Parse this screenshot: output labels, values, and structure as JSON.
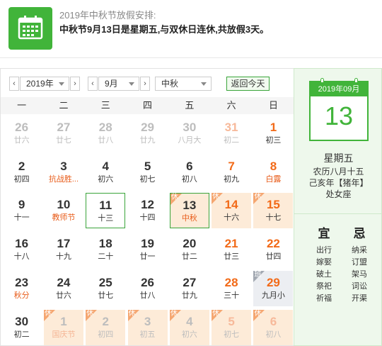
{
  "notice": {
    "title": "2019年中秋节放假安排:",
    "body": "中秋节9月13日是星期五,与双休日连休,共放假3天。",
    "icon": "calendar-icon"
  },
  "toolbar": {
    "prev_year": "‹",
    "year": "2019年",
    "next_year": "›",
    "prev_month": "‹",
    "month": "9月",
    "next_month": "›",
    "festival": "中秋",
    "today_label": "返回今天"
  },
  "weekdays": [
    "一",
    "二",
    "三",
    "四",
    "五",
    "六",
    "日"
  ],
  "days": [
    {
      "num": "26",
      "lunar": "廿六",
      "dim": true
    },
    {
      "num": "27",
      "lunar": "廿七",
      "dim": true
    },
    {
      "num": "28",
      "lunar": "廿八",
      "dim": true
    },
    {
      "num": "29",
      "lunar": "廿九",
      "dim": true
    },
    {
      "num": "30",
      "lunar": "八月大",
      "dim": true
    },
    {
      "num": "31",
      "lunar": "初二",
      "dim": true,
      "weekend": true
    },
    {
      "num": "1",
      "lunar": "初三",
      "weekend": true
    },
    {
      "num": "2",
      "lunar": "初四"
    },
    {
      "num": "3",
      "lunar": "抗战胜...",
      "red": true
    },
    {
      "num": "4",
      "lunar": "初六"
    },
    {
      "num": "5",
      "lunar": "初七"
    },
    {
      "num": "6",
      "lunar": "初八"
    },
    {
      "num": "7",
      "lunar": "初九",
      "weekend": true
    },
    {
      "num": "8",
      "lunar": "白露",
      "weekend": true,
      "red": true
    },
    {
      "num": "9",
      "lunar": "十一"
    },
    {
      "num": "10",
      "lunar": "教师节",
      "red": true
    },
    {
      "num": "11",
      "lunar": "十三",
      "today": true
    },
    {
      "num": "12",
      "lunar": "十四"
    },
    {
      "num": "13",
      "lunar": "中秋",
      "red": true,
      "rest": true,
      "selected": true
    },
    {
      "num": "14",
      "lunar": "十六",
      "weekend": true,
      "rest": true
    },
    {
      "num": "15",
      "lunar": "十七",
      "weekend": true,
      "rest": true
    },
    {
      "num": "16",
      "lunar": "十八"
    },
    {
      "num": "17",
      "lunar": "十九"
    },
    {
      "num": "18",
      "lunar": "二十"
    },
    {
      "num": "19",
      "lunar": "廿一"
    },
    {
      "num": "20",
      "lunar": "廿二"
    },
    {
      "num": "21",
      "lunar": "廿三",
      "weekend": true
    },
    {
      "num": "22",
      "lunar": "廿四",
      "weekend": true
    },
    {
      "num": "23",
      "lunar": "秋分",
      "red": true
    },
    {
      "num": "24",
      "lunar": "廿六"
    },
    {
      "num": "25",
      "lunar": "廿七"
    },
    {
      "num": "26",
      "lunar": "廿八"
    },
    {
      "num": "27",
      "lunar": "廿九"
    },
    {
      "num": "28",
      "lunar": "三十",
      "weekend": true
    },
    {
      "num": "29",
      "lunar": "九月小",
      "weekend": true,
      "work": true
    },
    {
      "num": "30",
      "lunar": "初二"
    },
    {
      "num": "1",
      "lunar": "国庆节",
      "dim": true,
      "red": true,
      "rest": true
    },
    {
      "num": "2",
      "lunar": "初四",
      "dim": true,
      "rest": true
    },
    {
      "num": "3",
      "lunar": "初五",
      "dim": true,
      "rest": true
    },
    {
      "num": "4",
      "lunar": "初六",
      "dim": true,
      "rest": true
    },
    {
      "num": "5",
      "lunar": "初七",
      "dim": true,
      "weekend": true,
      "rest": true
    },
    {
      "num": "6",
      "lunar": "初八",
      "dim": true,
      "weekend": true,
      "rest": true
    }
  ],
  "tags": {
    "rest": "休",
    "work": "班"
  },
  "detail": {
    "month": "2019年09月",
    "day": "13",
    "weekday": "星期五",
    "lunar": "农历八月十五",
    "ganzhi": "己亥年【猪年】",
    "constellation": "处女座",
    "yi_label": "宜",
    "ji_label": "忌",
    "yi": [
      "出行",
      "嫁娶",
      "破土",
      "祭祀",
      "祈福"
    ],
    "ji": [
      "纳采",
      "订盟",
      "架马",
      "词讼",
      "开渠"
    ]
  },
  "colors": {
    "accent": "#41b43a",
    "weekend": "#f26a18",
    "rest_bg": "#fdebd8",
    "work_bg": "#eceef2"
  }
}
